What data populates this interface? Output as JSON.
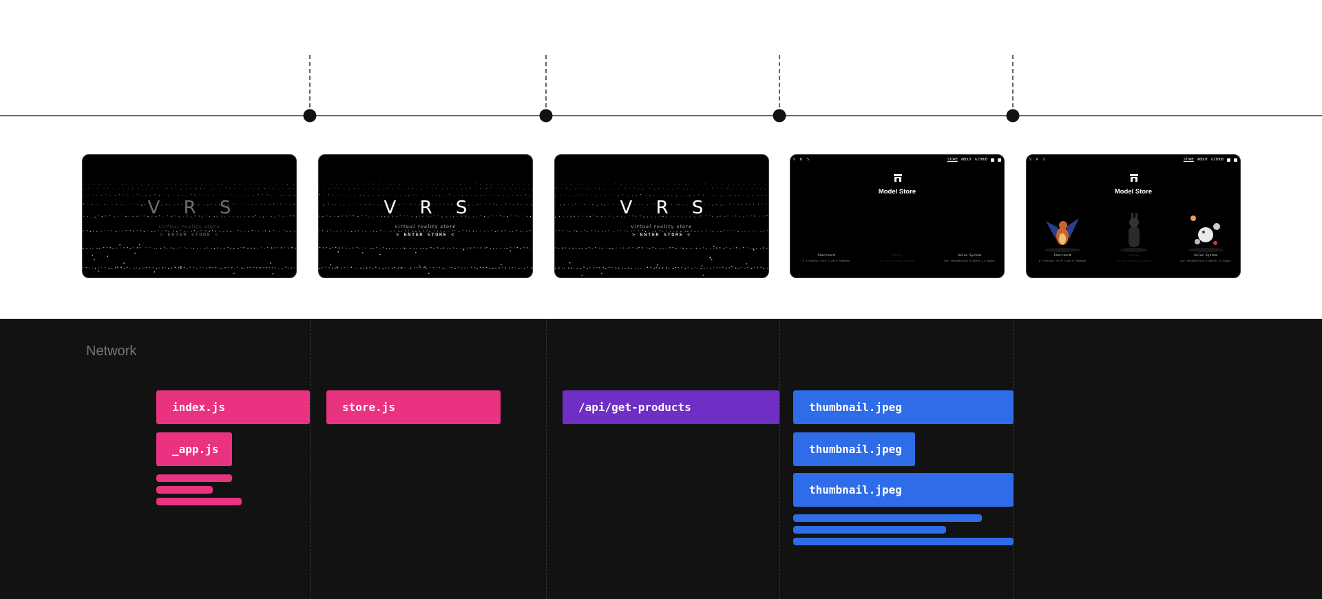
{
  "timeline": {
    "color": "#111111",
    "markers": [
      {
        "name": "marker-1"
      },
      {
        "name": "marker-2"
      },
      {
        "name": "marker-3"
      },
      {
        "name": "marker-4"
      }
    ]
  },
  "frames": [
    {
      "kind": "intro",
      "dim": true,
      "title": "V R S",
      "subtitle": "virtual reality store",
      "enter": "> ENTER STORE <"
    },
    {
      "kind": "intro",
      "dim": false,
      "title": "V R S",
      "subtitle": "virtual reality store",
      "enter": "> ENTER STORE <"
    },
    {
      "kind": "intro",
      "dim": false,
      "title": "V R S",
      "subtitle": "virtual reality store",
      "enter": "> ENTER STORE <"
    },
    {
      "kind": "store",
      "show_models": false,
      "logo": "V R S",
      "nav": [
        "STORE",
        "ABOUT",
        "GITHUB"
      ],
      "title": "Model Store",
      "products": [
        {
          "name": "Charizard",
          "desc": "A friendly fire lizard Pokemon",
          "faded": false
        },
        {
          "name": "Bunny",
          "desc": "An adventurous pioneer",
          "faded": true
        },
        {
          "name": "Solar System",
          "desc": "Our neighboring planets in Space",
          "faded": false
        }
      ]
    },
    {
      "kind": "store",
      "show_models": true,
      "logo": "V R S",
      "nav": [
        "STORE",
        "ABOUT",
        "GITHUB"
      ],
      "title": "Model Store",
      "products": [
        {
          "name": "Charizard",
          "desc": "A friendly fire lizard Pokemon",
          "faded": false
        },
        {
          "name": "Bunny",
          "desc": "An adventurous pioneer",
          "faded": true
        },
        {
          "name": "Solar System",
          "desc": "Our neighboring planets in Space",
          "faded": false
        }
      ]
    }
  ],
  "network": {
    "title": "Network",
    "colors": {
      "js": "#ea3380",
      "api": "#6f2fc4",
      "image": "#2f6ce8"
    },
    "requests": [
      {
        "label": "index.js",
        "type": "js"
      },
      {
        "label": "_app.js",
        "type": "js"
      },
      {
        "label": "store.js",
        "type": "js"
      },
      {
        "label": "/api/get-products",
        "type": "api"
      },
      {
        "label": "thumbnail.jpeg",
        "type": "image"
      },
      {
        "label": "thumbnail.jpeg",
        "type": "image"
      },
      {
        "label": "thumbnail.jpeg",
        "type": "image"
      }
    ],
    "bars": [
      {
        "type": "js"
      },
      {
        "type": "js"
      },
      {
        "type": "js"
      },
      {
        "type": "image"
      },
      {
        "type": "image"
      },
      {
        "type": "image"
      }
    ]
  }
}
